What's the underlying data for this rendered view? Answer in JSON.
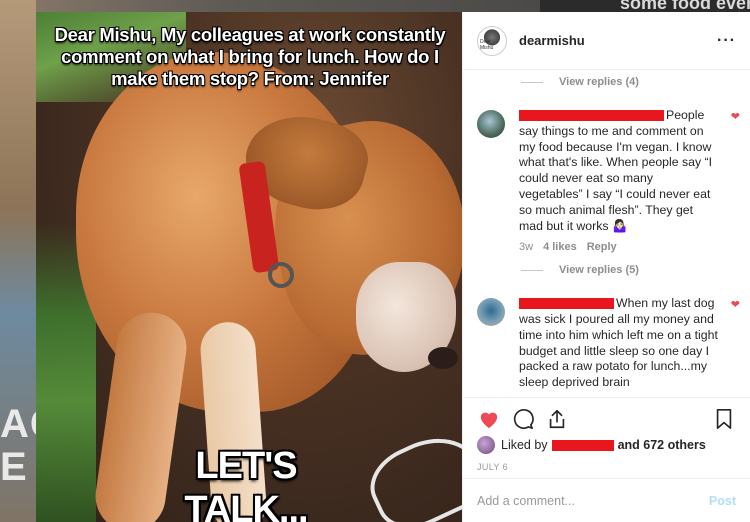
{
  "background": {
    "top_right_text": "some food every day. D",
    "left_word_1": "AG",
    "left_word_2": "E F"
  },
  "image": {
    "top_text": "Dear Mishu, My colleagues at work constantly comment on what I bring for lunch. How do I make them stop? From: Jennifer",
    "bottom_text": "LET'S TALK..."
  },
  "post": {
    "avatar_text": "Dear Mishu",
    "username": "dearmishu",
    "more_icon": "more-horizontal-icon",
    "more_label": "···"
  },
  "comments": {
    "view_replies_1": "View replies (4)",
    "comment_1": {
      "text": "People say things to me and comment on my food because I'm vegan. I know what that's like. When people say “I could never eat so many vegetables” I say “I could never eat so much animal flesh”. They get mad but it works 🤷🏻‍♀️",
      "time": "3w",
      "likes": "4 likes",
      "reply": "Reply"
    },
    "view_replies_2": "View replies (5)",
    "comment_2": {
      "text": "When my last dog was sick I poured all my money and time into him which left me on a tight budget and little sleep so one day I packed a raw potato for lunch...my sleep deprived brain"
    }
  },
  "actions": {
    "liked_prefix": "Liked by",
    "liked_suffix": "and 672 others",
    "date": "JULY 6",
    "comment_placeholder": "Add a comment...",
    "post_label": "Post"
  },
  "colors": {
    "heart_red": "#ed4956",
    "redaction_red": "#e8161d",
    "post_button_disabled": "#b2dffc"
  }
}
